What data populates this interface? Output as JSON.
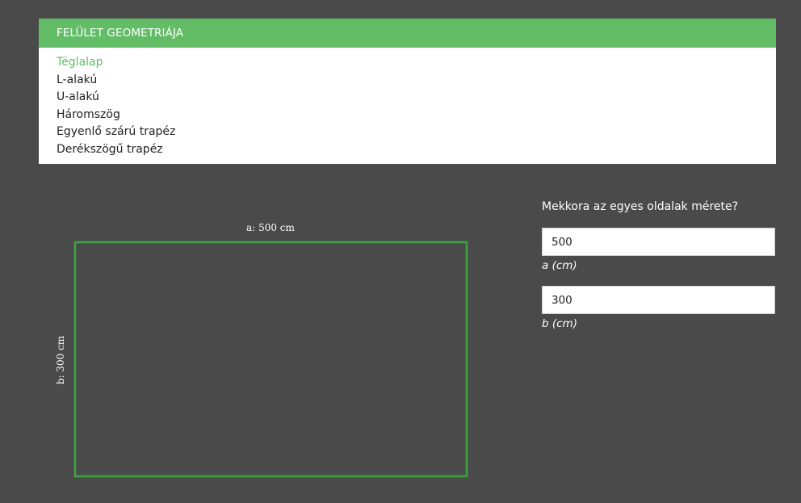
{
  "panel": {
    "title": "FELÜLET GEOMETRIÁJA",
    "shapes": [
      {
        "label": "Téglalap",
        "active": true
      },
      {
        "label": "L-alakú",
        "active": false
      },
      {
        "label": "U-alakú",
        "active": false
      },
      {
        "label": "Háromszög",
        "active": false
      },
      {
        "label": "Egyenlő szárú trapéz",
        "active": false
      },
      {
        "label": "Derékszögű trapéz",
        "active": false
      }
    ]
  },
  "drawing": {
    "top_label": "a: 500 cm",
    "side_label": "b: 300 cm",
    "stroke_color": "#3aa63f"
  },
  "form": {
    "question": "Mekkora az egyes oldalak mérete?",
    "fields": [
      {
        "value": "500",
        "unit": "a (cm)"
      },
      {
        "value": "300",
        "unit": "b (cm)"
      }
    ]
  },
  "colors": {
    "background": "#4a4a4a",
    "accent": "#62bd66"
  }
}
